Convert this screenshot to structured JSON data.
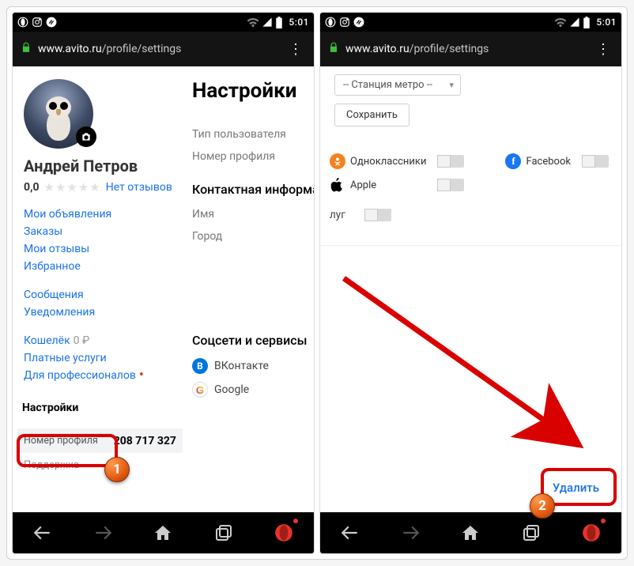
{
  "statusbar": {
    "time": "5:01"
  },
  "urlbar": {
    "domain": "www.avito.ru",
    "path": "/profile/settings"
  },
  "left": {
    "user_name": "Андрей Петров",
    "rating_score": "0,0",
    "no_reviews": "Нет отзывов",
    "menu1": [
      "Мои объявления",
      "Заказы",
      "Мои отзывы",
      "Избранное"
    ],
    "menu2": [
      "Сообщения",
      "Уведомления"
    ],
    "wallet_label": "Кошелёк",
    "wallet_value": "0 ₽",
    "paid_services": "Платные услуги",
    "for_pro": "Для профессионалов",
    "settings_label": "Настройки",
    "profile_num_label": "Номер профиля",
    "profile_num_value": "208 717 327",
    "support": "Поддержка",
    "page_title": "Настройки",
    "field_user_type": "Тип пользователя",
    "field_profile_num": "Номер профиля",
    "section_contact": "Контактная информация",
    "field_name": "Имя",
    "field_city": "Город",
    "section_social": "Соцсети и сервисы",
    "soc_vk": "ВКонтакте",
    "soc_google": "Google"
  },
  "right": {
    "metro_placeholder": "-- Станция метро --",
    "save_btn": "Сохранить",
    "soc_ok": "Одноклассники",
    "soc_fb": "Facebook",
    "soc_apple": "Apple",
    "lug": "луг",
    "delete_label": "Удалить"
  },
  "annot": {
    "n1": "1",
    "n2": "2"
  }
}
